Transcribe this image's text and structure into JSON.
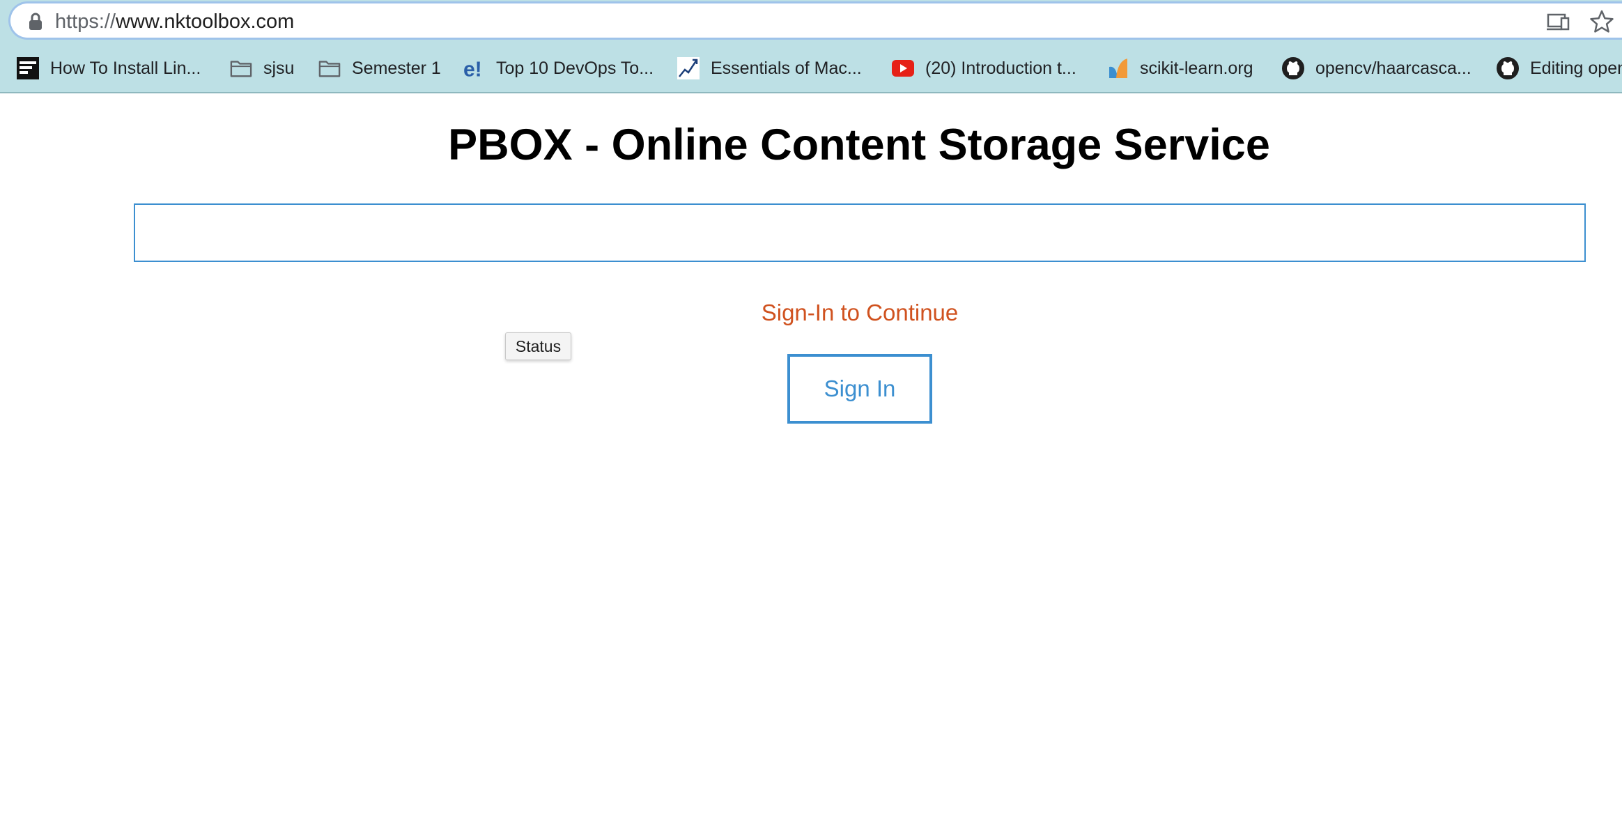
{
  "browser": {
    "url_scheme": "https://",
    "url_host": "www.nktoolbox.com",
    "icons": {
      "lock": "lock-icon",
      "install_app": "install-app-icon",
      "bookmark_star": "star-icon"
    },
    "bookmarks": [
      {
        "label": "How To Install Lin...",
        "icon": "makeuseof-icon"
      },
      {
        "label": "sjsu",
        "icon": "folder-icon"
      },
      {
        "label": "Semester 1",
        "icon": "folder-icon"
      },
      {
        "label": "Top 10 DevOps To...",
        "icon": "edureka-icon"
      },
      {
        "label": "Essentials of Mac...",
        "icon": "chart-line-icon"
      },
      {
        "label": "(20) Introduction t...",
        "icon": "youtube-icon"
      },
      {
        "label": "scikit-learn.org",
        "icon": "scikit-learn-icon"
      },
      {
        "label": "opencv/haarcasca...",
        "icon": "github-icon"
      },
      {
        "label": "Editing open",
        "icon": "github-icon"
      }
    ]
  },
  "page": {
    "title": "PBOX - Online Content Storage Service",
    "input_value": "",
    "signin_message": "Sign-In to Continue",
    "tooltip": "Status",
    "signin_button": "Sign In"
  },
  "colors": {
    "accent_blue": "#3c8fd0",
    "message_orange": "#d0521f",
    "bookmarks_bar_bg": "#bde0e5"
  }
}
